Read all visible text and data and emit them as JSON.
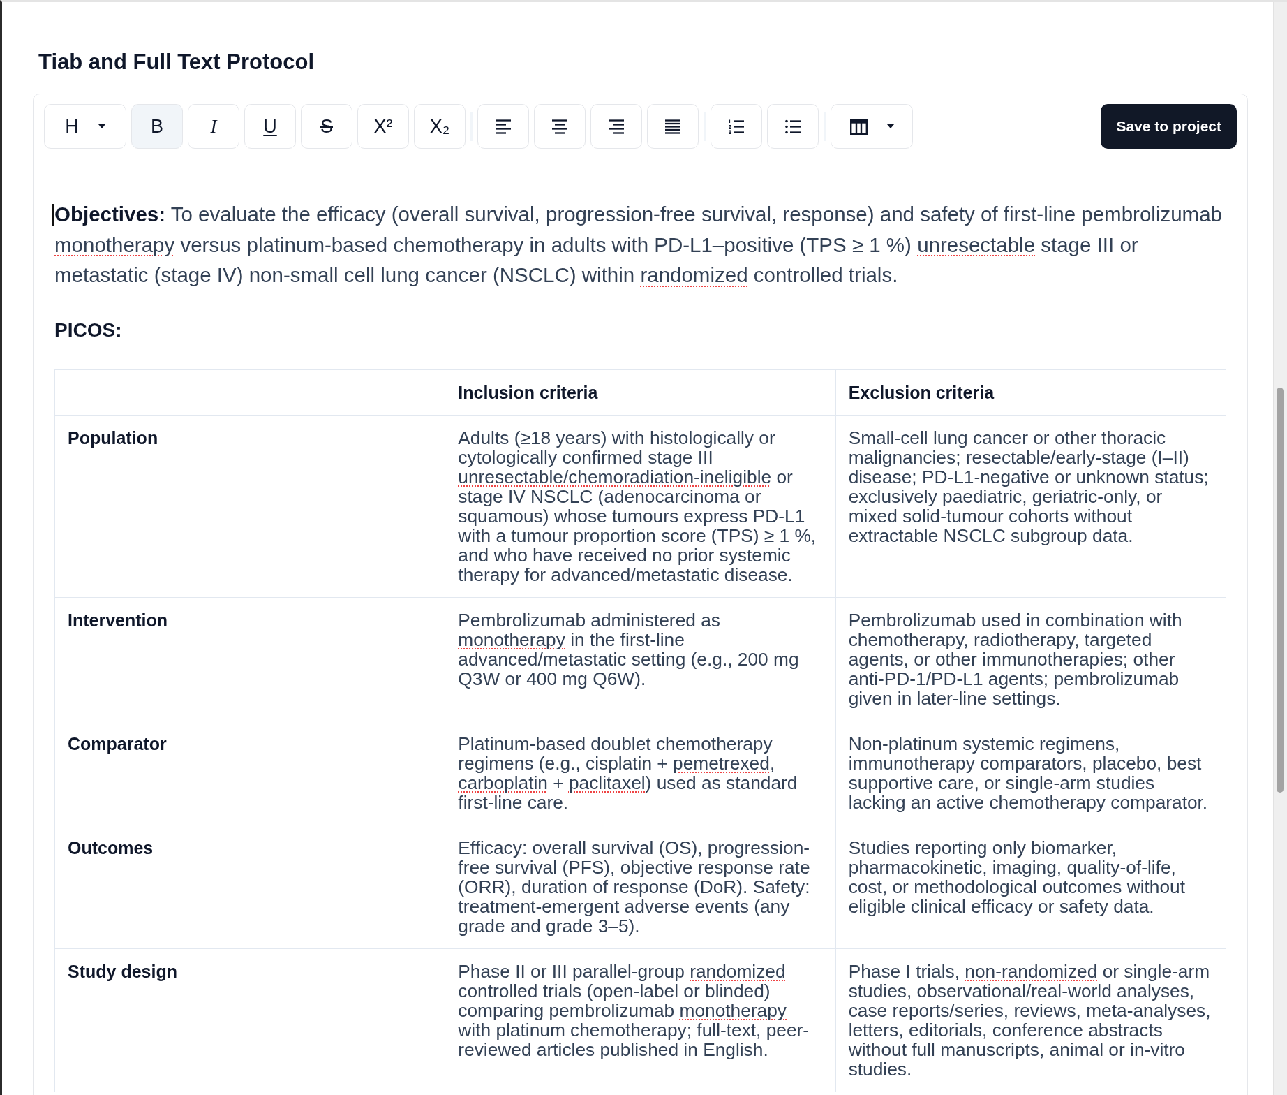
{
  "page_title": "Tiab and Full Text Protocol",
  "toolbar": {
    "groups": [
      [
        {
          "kind": "heading",
          "label": "H",
          "active": false
        },
        {
          "kind": "letter",
          "label": "B",
          "active": true
        },
        {
          "kind": "italic",
          "label": "I",
          "active": false
        },
        {
          "kind": "underline",
          "label": "U",
          "active": false
        },
        {
          "kind": "strike",
          "label": "S",
          "active": false
        },
        {
          "kind": "letter",
          "label": "X²",
          "active": false
        },
        {
          "kind": "letter",
          "label": "X₂",
          "active": false
        }
      ],
      [
        {
          "kind": "alignleft",
          "active": false
        },
        {
          "kind": "aligncenter",
          "active": false
        },
        {
          "kind": "alignright",
          "active": false
        },
        {
          "kind": "justify",
          "active": false
        }
      ],
      [
        {
          "kind": "ordered",
          "active": false
        },
        {
          "kind": "bullets",
          "active": false
        }
      ],
      [
        {
          "kind": "table",
          "active": false
        }
      ]
    ],
    "save_button": "Save to project"
  },
  "editor": {
    "objectives": [
      {
        "text": "**Objectives:** To evaluate the efficacy (overall survival, progression-free survival, response) and safety of first-line pembrolizumab ",
        "flagged": false
      },
      {
        "text": "monotherapy",
        "flagged": true
      },
      {
        "text": " versus platinum-based chemotherapy in adults with PD-L1–positive (TPS ≥ 1 %) ",
        "flagged": false
      },
      {
        "text": "unresectable",
        "flagged": true
      },
      {
        "text": " stage III or metastatic (stage IV) non-small cell lung cancer (NSCLC) within ",
        "flagged": false
      },
      {
        "text": "randomized",
        "flagged": true
      },
      {
        "text": " controlled trials.",
        "flagged": false
      }
    ],
    "picos_heading": "PICOS:",
    "table": {
      "column_headers": [
        "Inclusion criteria",
        "Exclusion criteria"
      ],
      "rows": [
        {
          "label": "Population",
          "cells": [
            [
              {
                "text": "Adults (≥18 years) with histologically or cytologically confirmed stage III ",
                "flagged": false
              },
              {
                "text": "unresectable/chemoradiation-ineligible",
                "flagged": true
              },
              {
                "text": " or stage IV NSCLC (adenocarcinoma or squamous) whose tumours express PD-L1 with a tumour proportion score (TPS) ≥ 1 %, and who have received no prior systemic therapy for advanced/metastatic disease.",
                "flagged": false
              }
            ],
            [
              {
                "text": "Small-cell lung cancer or other thoracic malignancies; resectable/early-stage (I–II) disease; PD-L1-negative or unknown status; exclusively paediatric, geriatric-only, or mixed solid-tumour cohorts without extractable NSCLC subgroup data.",
                "flagged": false
              }
            ]
          ]
        },
        {
          "label": "Intervention",
          "cells": [
            [
              {
                "text": "Pembrolizumab administered as ",
                "flagged": false
              },
              {
                "text": "monotherapy",
                "flagged": true
              },
              {
                "text": " in the first-line advanced/metastatic setting (e.g., 200 mg Q3W or 400 mg Q6W).",
                "flagged": false
              }
            ],
            [
              {
                "text": "Pembrolizumab used in combination with chemotherapy, radiotherapy, targeted agents, or other immunotherapies; other anti-PD-1/PD-L1 agents; pembrolizumab given in later-line settings.",
                "flagged": false
              }
            ]
          ]
        },
        {
          "label": "Comparator",
          "cells": [
            [
              {
                "text": "Platinum-based doublet chemotherapy regimens (e.g., cisplatin + ",
                "flagged": false
              },
              {
                "text": "pemetrexed",
                "flagged": true
              },
              {
                "text": ", ",
                "flagged": false
              },
              {
                "text": "carboplatin",
                "flagged": true
              },
              {
                "text": " + ",
                "flagged": false
              },
              {
                "text": "paclitaxel",
                "flagged": true
              },
              {
                "text": ") used as standard first-line care.",
                "flagged": false
              }
            ],
            [
              {
                "text": "Non-platinum systemic regimens, immunotherapy comparators, placebo, best supportive care, or single-arm studies lacking an active chemotherapy comparator.",
                "flagged": false
              }
            ]
          ]
        },
        {
          "label": "Outcomes",
          "cells": [
            [
              {
                "text": "Efficacy: overall survival (OS), progression-free survival (PFS), objective response rate (ORR), duration of response (DoR). Safety: treatment-emergent adverse events (any grade and grade 3–5).",
                "flagged": false
              }
            ],
            [
              {
                "text": "Studies reporting only biomarker, pharmacokinetic, imaging, quality-of-life, cost, or methodological outcomes without eligible clinical efficacy or safety data.",
                "flagged": false
              }
            ]
          ]
        },
        {
          "label": "Study design",
          "cells": [
            [
              {
                "text": "Phase II or III parallel-group ",
                "flagged": false
              },
              {
                "text": "randomized",
                "flagged": true
              },
              {
                "text": " controlled trials (open-label or blinded) comparing pembrolizumab ",
                "flagged": false
              },
              {
                "text": "monotherapy",
                "flagged": true
              },
              {
                "text": " with platinum chemotherapy; full-text, peer-reviewed articles published in English.",
                "flagged": false
              }
            ],
            [
              {
                "text": "Phase I trials, ",
                "flagged": false
              },
              {
                "text": "non-randomized",
                "flagged": true
              },
              {
                "text": " or single-arm studies, observational/real-world analyses, case reports/series, reviews, meta-analyses, letters, editorials, conference abstracts without full manuscripts, animal or in-vitro studies.",
                "flagged": false
              }
            ]
          ]
        }
      ]
    }
  }
}
